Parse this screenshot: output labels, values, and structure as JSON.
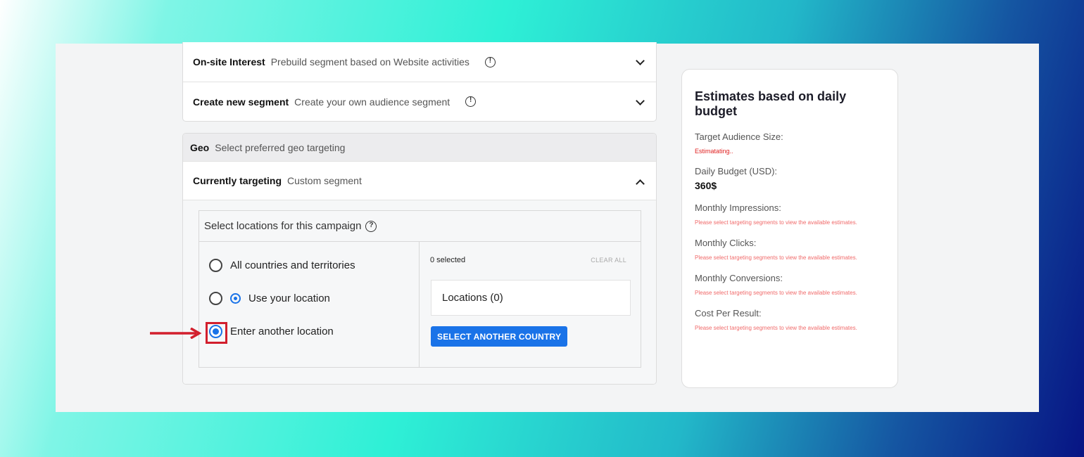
{
  "segments": [
    {
      "title": "On-site Interest",
      "desc": "Prebuild segment based on Website activities"
    },
    {
      "title": "Create new segment",
      "desc": "Create your own audience segment"
    }
  ],
  "geo": {
    "title": "Geo",
    "desc": "Select preferred geo targeting",
    "currently_label": "Currently targeting",
    "currently_value": "Custom segment",
    "locations_prompt": "Select locations for this campaign",
    "options": [
      {
        "label": "All countries and territories",
        "selected": false
      },
      {
        "label": "Use your location",
        "selected": false
      },
      {
        "label": "Enter another location",
        "selected": true
      }
    ],
    "selected_count": "0 selected",
    "clear_all": "CLEAR ALL",
    "locations_label": "Locations (0)",
    "select_country_button": "SELECT ANOTHER COUNTRY"
  },
  "estimates": {
    "title": "Estimates based on daily budget",
    "audience_label": "Target Audience Size:",
    "audience_value": "Estimatating..",
    "budget_label": "Daily Budget (USD):",
    "budget_value": "360$",
    "impressions_label": "Monthly Impressions:",
    "clicks_label": "Monthly Clicks:",
    "conversions_label": "Monthly Conversions:",
    "cpr_label": "Cost Per Result:",
    "note": "Please select targeting segments to view the available estimates."
  },
  "colors": {
    "accent": "#1a73e8",
    "highlight": "#d21f2d",
    "warning": "#f06a6a"
  }
}
